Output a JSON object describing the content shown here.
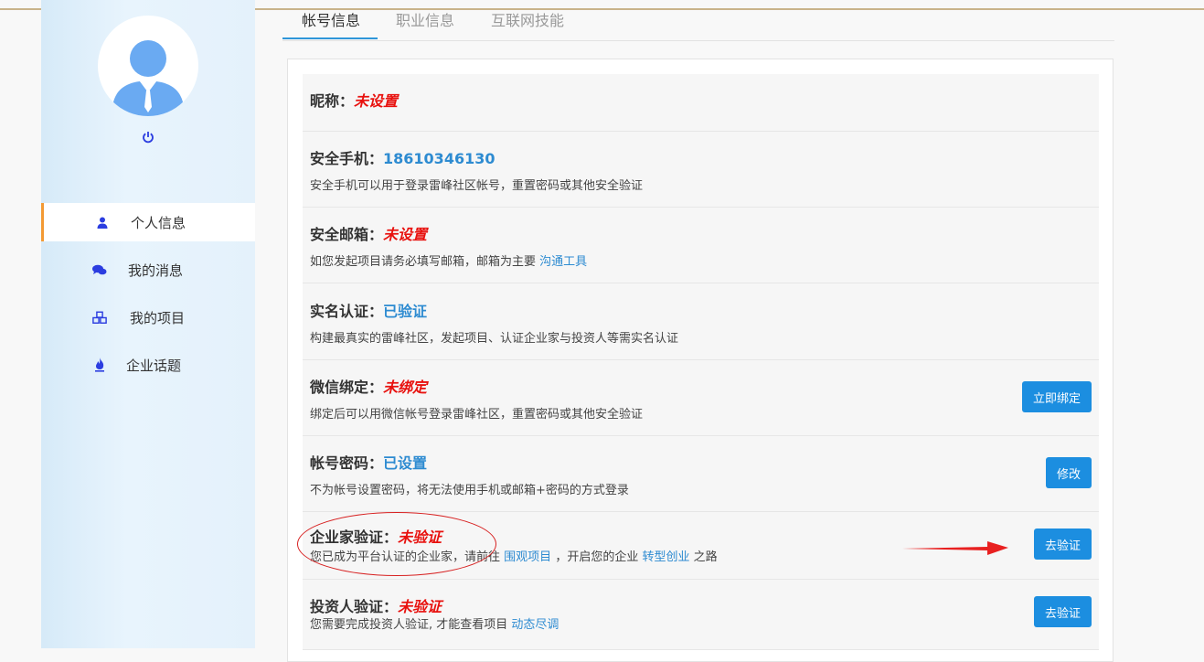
{
  "tabs": [
    {
      "label": "帐号信息",
      "active": true
    },
    {
      "label": "职业信息",
      "active": false
    },
    {
      "label": "互联网技能",
      "active": false
    }
  ],
  "sidebar": {
    "items": [
      {
        "label": "个人信息",
        "icon": "user-icon",
        "active": true
      },
      {
        "label": "我的消息",
        "icon": "chat-icon",
        "active": false
      },
      {
        "label": "我的项目",
        "icon": "cubes-icon",
        "active": false
      },
      {
        "label": "企业话题",
        "icon": "fire-icon",
        "active": false
      }
    ]
  },
  "account": {
    "nickname": {
      "label": "昵称：",
      "value": "未设置"
    },
    "phone": {
      "label": "安全手机：",
      "value": "18610346130",
      "desc": "安全手机可以用于登录雷峰社区帐号，重置密码或其他安全验证"
    },
    "email": {
      "label": "安全邮箱：",
      "value": "未设置",
      "desc": "如您发起项目请务必填写邮箱，邮箱为主要",
      "link": "沟通工具"
    },
    "realname": {
      "label": "实名认证：",
      "value": "已验证",
      "desc": "构建最真实的雷峰社区，发起项目、认证企业家与投资人等需实名认证"
    },
    "wechat": {
      "label": "微信绑定：",
      "value": "未绑定",
      "desc": "绑定后可以用微信帐号登录雷峰社区，重置密码或其他安全验证",
      "button": "立即绑定"
    },
    "password": {
      "label": "帐号密码：",
      "value": "已设置",
      "desc": "不为帐号设置密码，将无法使用手机或邮箱+密码的方式登录",
      "button": "修改"
    },
    "entrepreneur": {
      "label": "企业家验证：",
      "value": "未验证",
      "desc_pre": "您已成为平台认证的企业家，请前往",
      "link1": "围观项目",
      "desc_mid": "，开启您的企业",
      "link2": "转型创业",
      "desc_post": "之路",
      "button": "去验证"
    },
    "investor": {
      "label": "投资人验证：",
      "value": "未验证",
      "desc": "您需要完成投资人验证, 才能查看项目",
      "link": "动态尽调",
      "button": "去验证"
    }
  },
  "colors": {
    "accent": "#1c8ee0",
    "warning": "#e8110e",
    "link": "#2d8bd1",
    "active_border": "#f39a34"
  }
}
